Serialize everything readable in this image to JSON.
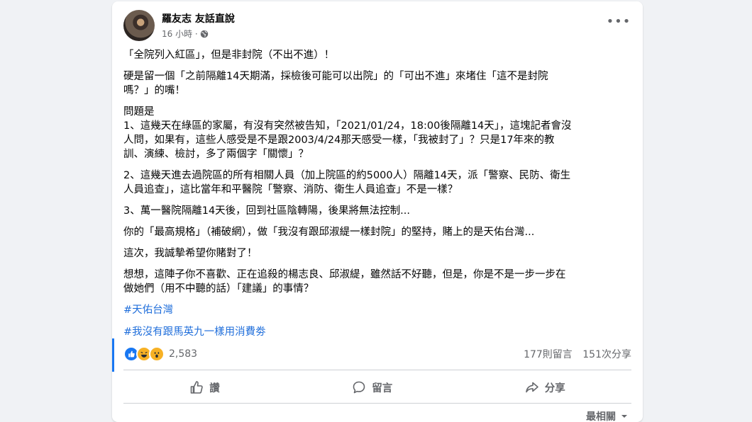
{
  "post": {
    "author": "羅友志 友話直說",
    "time": "16 小時 ·",
    "paragraphs": [
      "「全院列入紅區」，但是非封院（不出不進）！",
      "硬是留一個「之前隔離14天期滿，採檢後可能可以出院」的「可出不進」來堵住「這不是封院\n嗎？」的嘴！",
      "問題是\n1、這幾天在綠區的家屬，有沒有突然被告知，「2021/01/24，18:00後隔離14天」，這塊記者會沒\n人問，如果有，這些人感受是不是跟2003/4/24那天感受一樣，「我被封了」？只是17年來的教\n訓、演練、檢討，多了兩個字「關懷」？",
      "2、這幾天進去過院區的所有相關人員（加上院區的約5000人）隔離14天，派「警察、民防、衛生\n人員追查」，這比當年和平醫院「警察、消防、衛生人員追查」不是一樣？",
      "3、萬一醫院隔離14天後，回到社區陰轉陽，後果將無法控制...",
      "你的「最高規格」（補破網），做「我沒有跟邱淑緹一樣封院」的堅持，賭上的是天佑台灣...",
      "這次，我誠摯希望你賭對了！",
      "想想，這陣子你不喜歡、正在追殺的楊志良、邱淑緹，雖然話不好聽，但是，你是不是一步一步在\n做她們（用不中聽的話）「建議」的事情？"
    ],
    "hashtags": [
      "#天佑台灣",
      "#我沒有跟馬英九一樣用消費劵"
    ]
  },
  "stats": {
    "reaction_count": "2,583",
    "comments": "177則留言",
    "shares": "151次分享"
  },
  "actions": {
    "like": "讚",
    "comment": "留言",
    "share": "分享"
  },
  "sort": {
    "label": "最相關"
  },
  "icons": [
    "more-icon",
    "globe-icon",
    "like-reaction-icon",
    "haha-reaction-icon",
    "wow-reaction-icon",
    "thumbs-up-icon",
    "comment-icon",
    "share-icon",
    "caret-down-icon"
  ],
  "colors": {
    "link": "#216fdb",
    "accent": "#1877f2",
    "muted": "#65676b",
    "background": "#f0f2f5"
  }
}
